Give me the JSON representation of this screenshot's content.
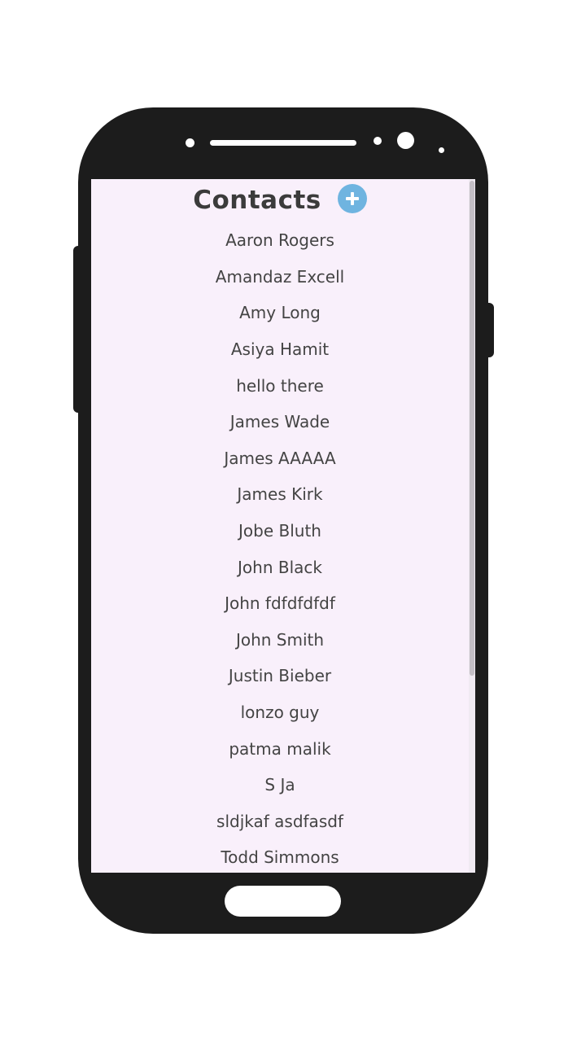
{
  "app": {
    "title": "Contacts",
    "add_icon": "plus-circle-icon",
    "accent_color": "#6fb4e0"
  },
  "contacts": [
    "Aaron Rogers",
    "Amandaz Excell",
    "Amy Long",
    "Asiya Hamit",
    "hello there",
    "James Wade",
    "James AAAAA",
    "James Kirk",
    "Jobe Bluth",
    "John Black",
    "John fdfdfdfdf",
    "John Smith",
    "Justin Bieber",
    "lonzo guy",
    "patma malik",
    "S Ja",
    "sldjkaf asdfasdf",
    "Todd Simmons"
  ]
}
